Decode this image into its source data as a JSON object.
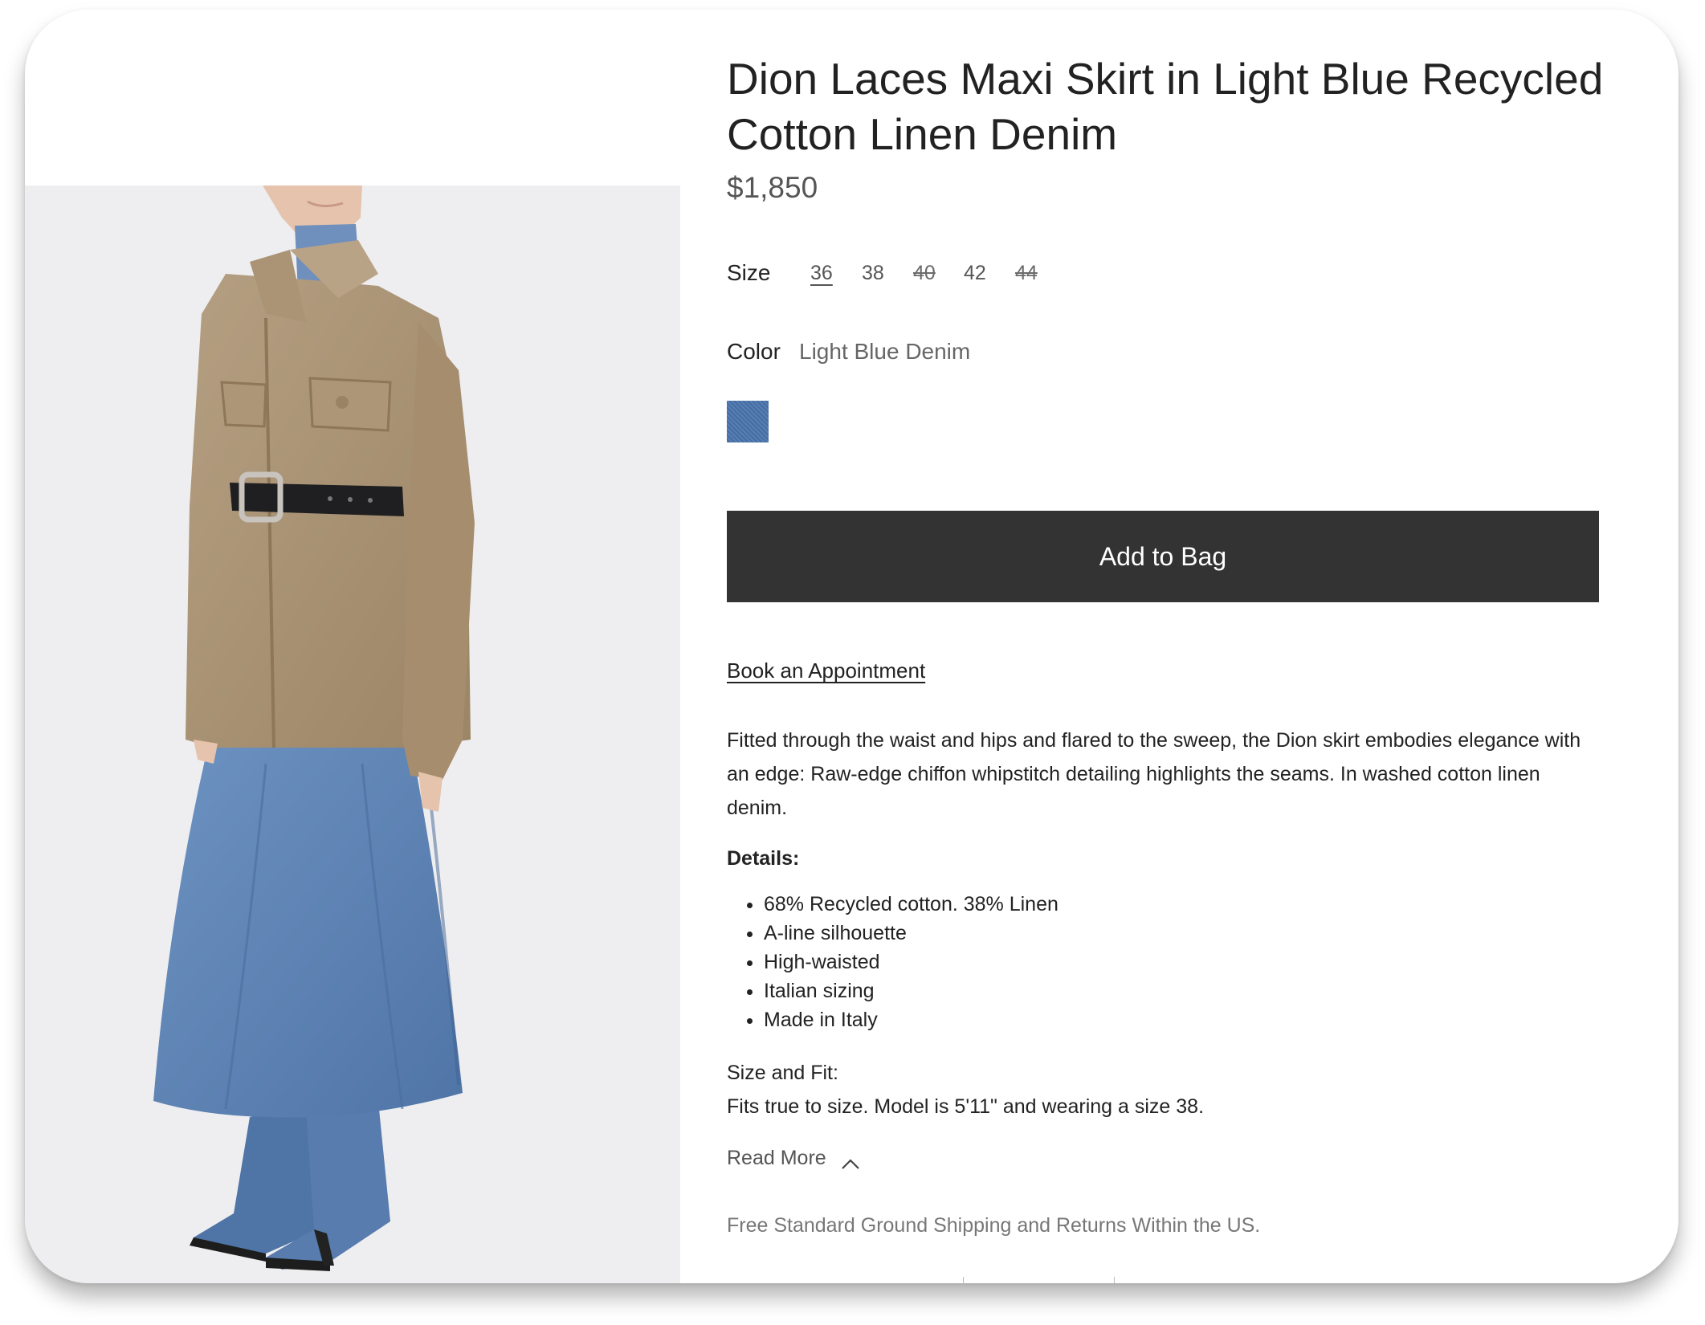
{
  "product": {
    "title": "Dion Laces Maxi Skirt in Light Blue Recycled Cotton Linen Denim",
    "price": "$1,850",
    "image_alt": "Model wearing the Dion Laces Maxi Skirt with a suede belted jacket and denim boots"
  },
  "size": {
    "label": "Size",
    "options": [
      {
        "label": "36",
        "state": "selected"
      },
      {
        "label": "38",
        "state": "available"
      },
      {
        "label": "40",
        "state": "unavailable"
      },
      {
        "label": "42",
        "state": "available"
      },
      {
        "label": "44",
        "state": "unavailable"
      }
    ]
  },
  "color": {
    "label": "Color",
    "value": "Light Blue Denim",
    "swatch_color": "#4a74ad"
  },
  "actions": {
    "add_to_bag": "Add to Bag",
    "book_appointment": "Book an Appointment"
  },
  "description": "Fitted through the waist and hips and flared to the sweep, the Dion skirt embodies elegance with an edge: Raw-edge chiffon whipstitch detailing highlights the seams. In washed cotton linen denim.",
  "details": {
    "heading": "Details:",
    "items": [
      "68% Recycled cotton. 38% Linen",
      "A-line silhouette",
      "High-waisted",
      "Italian sizing",
      "Made in Italy"
    ]
  },
  "size_fit": {
    "heading": "Size and Fit:",
    "text": "Fits true to size. Model is 5'11\" and wearing a size 38."
  },
  "read_more": {
    "label": "Read More",
    "icon": "chevron-up-icon"
  },
  "shipping": "Free Standard Ground Shipping and Returns Within the US.",
  "colors": {
    "button_bg": "#333333",
    "text_primary": "#222222",
    "text_muted": "#777777",
    "photo_bg": "#eeeef0"
  }
}
